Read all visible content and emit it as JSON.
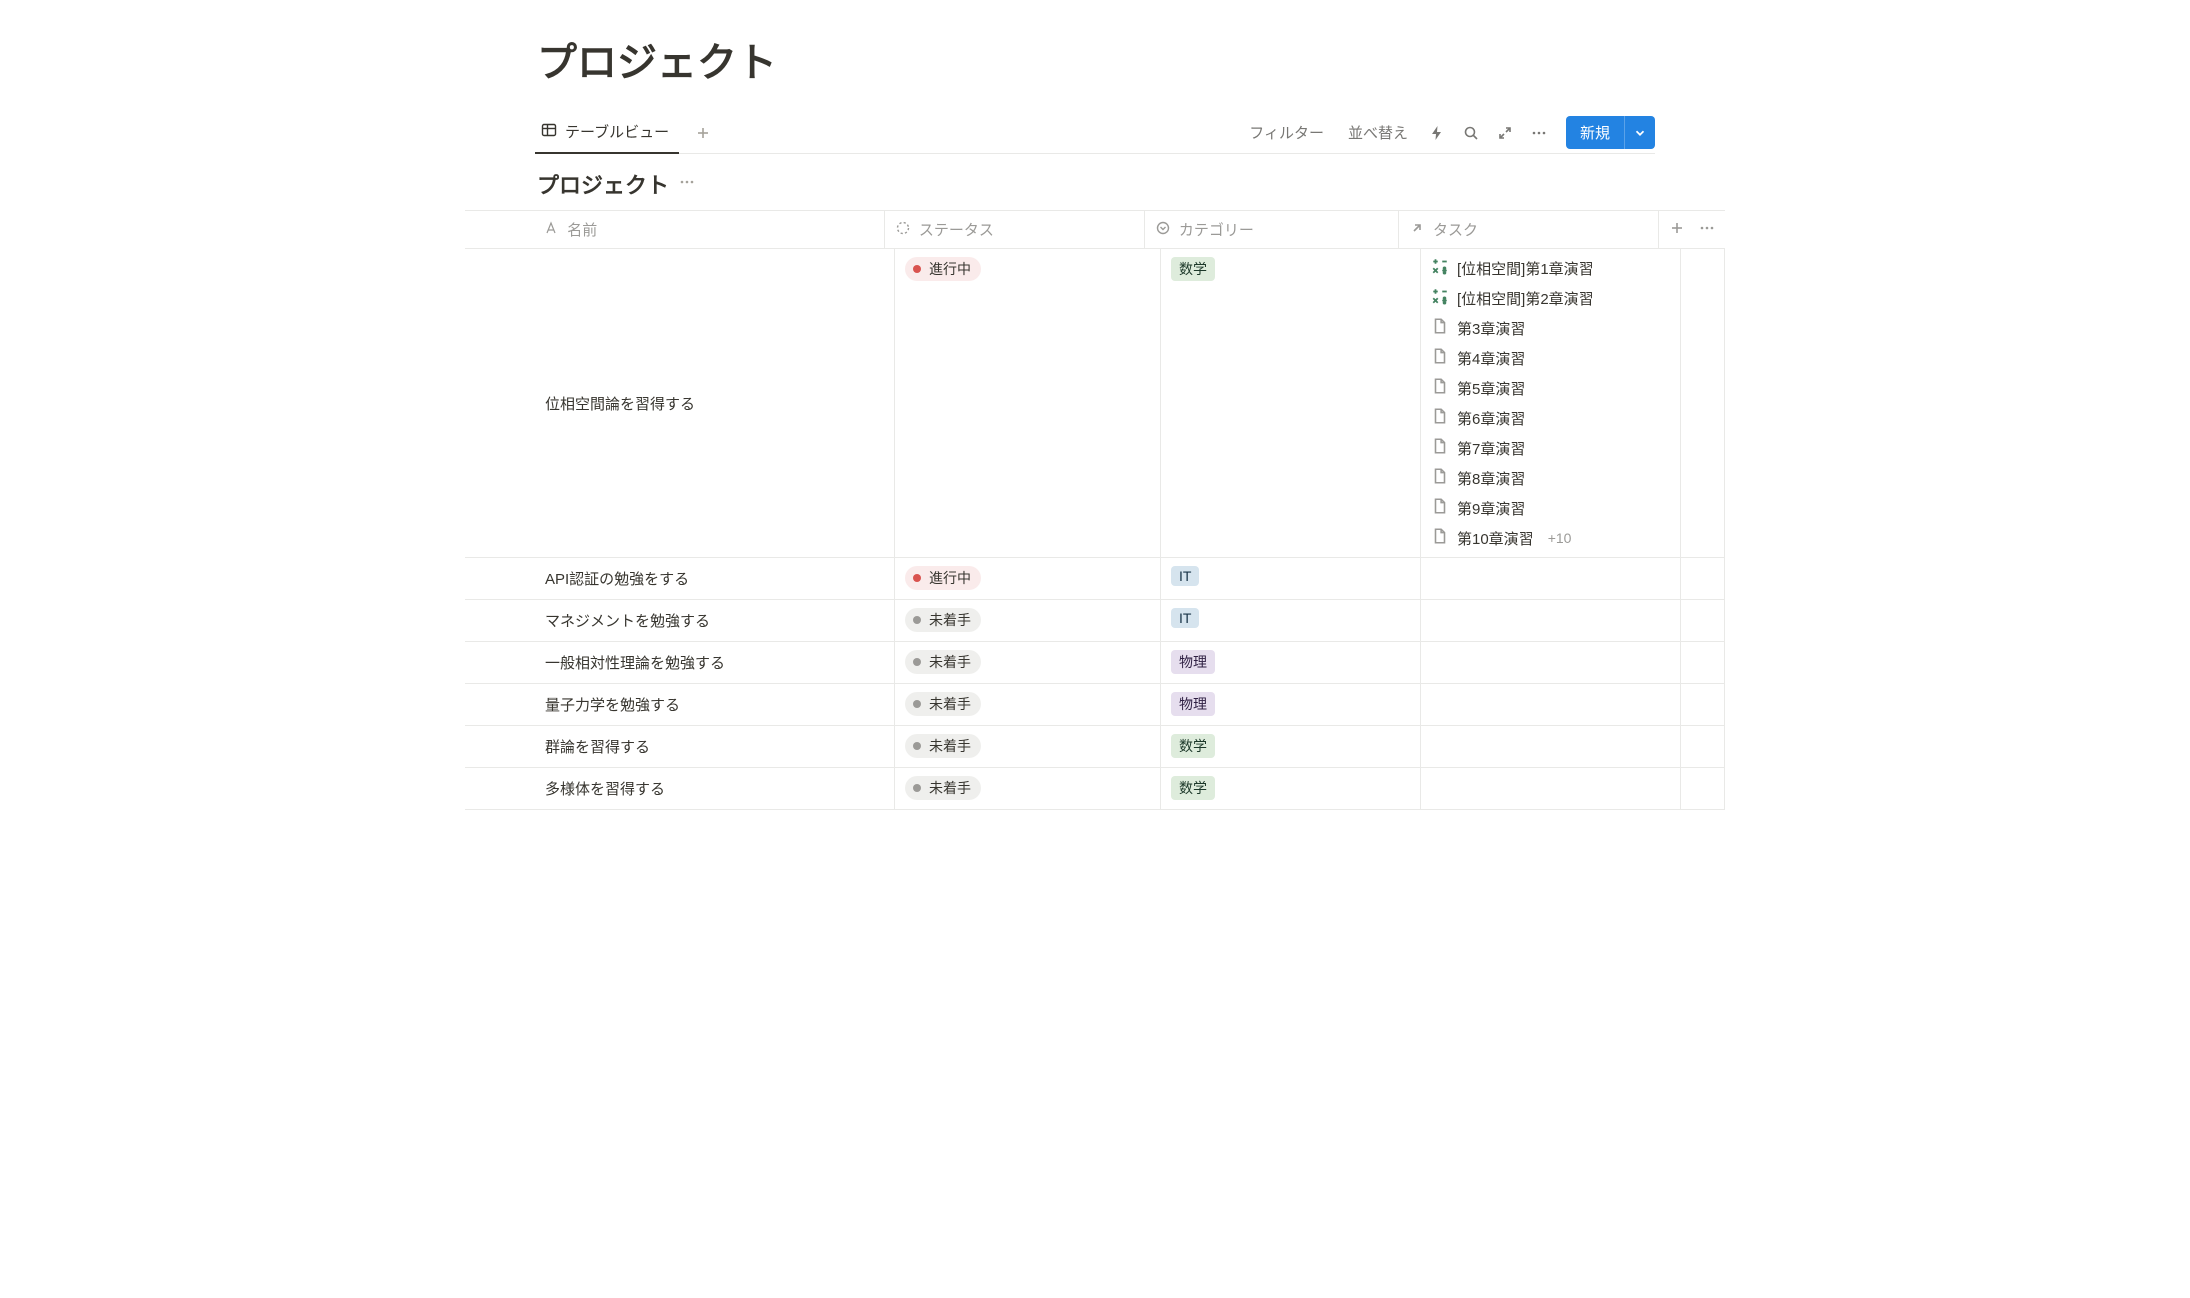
{
  "page": {
    "title": "プロジェクト"
  },
  "views": {
    "active_tab_label": "テーブルビュー"
  },
  "toolbar": {
    "filter_label": "フィルター",
    "sort_label": "並べ替え",
    "new_label": "新規"
  },
  "database": {
    "title": "プロジェクト"
  },
  "columns": {
    "name": "名前",
    "status": "ステータス",
    "category": "カテゴリー",
    "tasks": "タスク"
  },
  "status_labels": {
    "in_progress": "進行中",
    "not_started": "未着手"
  },
  "category_labels": {
    "math": "数学",
    "it": "IT",
    "physics": "物理"
  },
  "rows": [
    {
      "name": "位相空間論を習得する",
      "status": "in_progress",
      "category": "math",
      "tasks": [
        {
          "icon": "math",
          "label": "[位相空間]第1章演習"
        },
        {
          "icon": "math",
          "label": "[位相空間]第2章演習"
        },
        {
          "icon": "page",
          "label": "第3章演習"
        },
        {
          "icon": "page",
          "label": "第4章演習"
        },
        {
          "icon": "page",
          "label": "第5章演習"
        },
        {
          "icon": "page",
          "label": "第6章演習"
        },
        {
          "icon": "page",
          "label": "第7章演習"
        },
        {
          "icon": "page",
          "label": "第8章演習"
        },
        {
          "icon": "page",
          "label": "第9章演習"
        },
        {
          "icon": "page",
          "label": "第10章演習",
          "more": "+10"
        }
      ]
    },
    {
      "name": "API認証の勉強をする",
      "status": "in_progress",
      "category": "it",
      "tasks": []
    },
    {
      "name": "マネジメントを勉強する",
      "status": "not_started",
      "category": "it",
      "tasks": []
    },
    {
      "name": "一般相対性理論を勉強する",
      "status": "not_started",
      "category": "physics",
      "tasks": []
    },
    {
      "name": "量子力学を勉強する",
      "status": "not_started",
      "category": "physics",
      "tasks": []
    },
    {
      "name": "群論を習得する",
      "status": "not_started",
      "category": "math",
      "tasks": []
    },
    {
      "name": "多様体を習得する",
      "status": "not_started",
      "category": "math",
      "tasks": []
    }
  ]
}
